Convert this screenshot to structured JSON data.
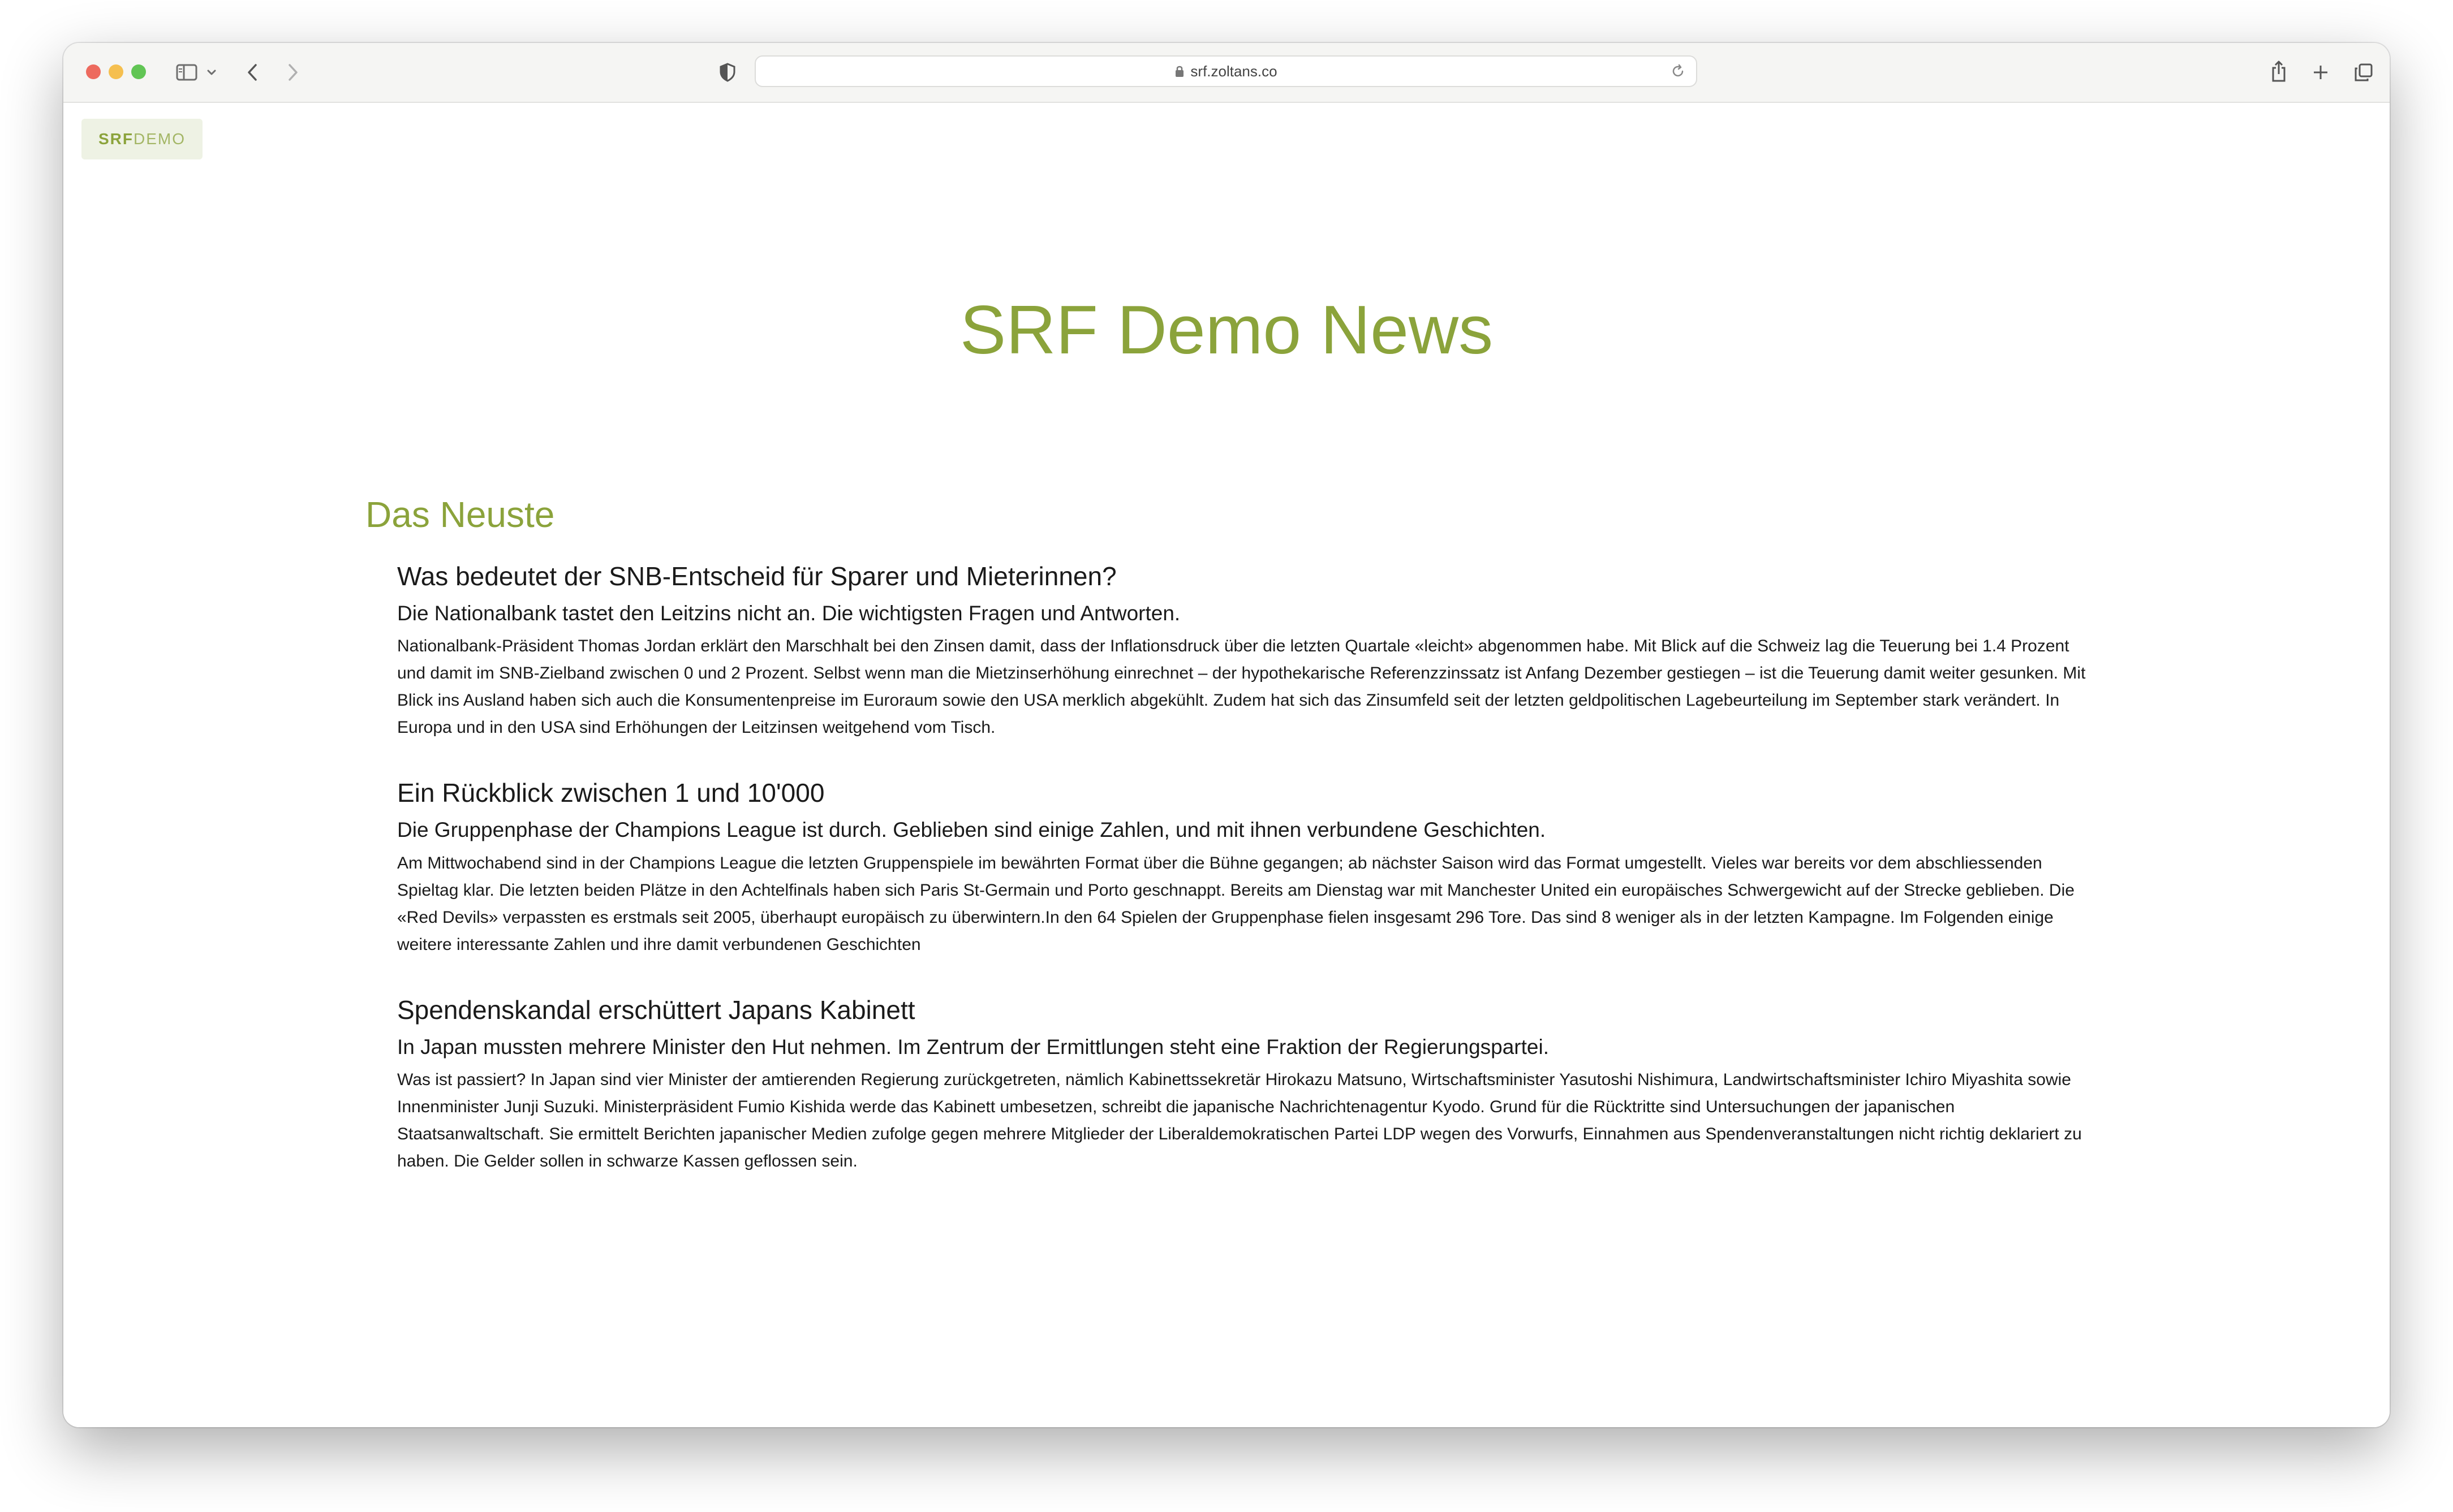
{
  "browser": {
    "url": "srf.zoltans.co",
    "icons": {
      "sidebar": "sidebar-icon",
      "sidebar_menu": "chevron-down-icon",
      "back": "back-arrow-icon",
      "forward": "forward-arrow-icon",
      "privacy": "shield-icon",
      "lock": "lock-icon",
      "reload": "reload-icon",
      "share": "share-icon",
      "new_tab": "plus-icon",
      "tabs": "tabs-overview-icon"
    }
  },
  "site": {
    "logo_srf": "SRF",
    "logo_demo": "DEMO",
    "title": "SRF Demo News",
    "section_title": "Das Neuste",
    "accent_color": "#8ba33b"
  },
  "articles": [
    {
      "title": "Was bedeutet der SNB-Entscheid für Sparer und Mieterinnen?",
      "lead": "Die Nationalbank tastet den Leitzins nicht an. Die wichtigsten Fragen und Antworten.",
      "body": "Nationalbank-Präsident Thomas Jordan erklärt den Marschhalt bei den Zinsen damit, dass der Inflationsdruck über die letzten Quartale «leicht» abgenommen habe. Mit Blick auf die Schweiz lag die Teuerung bei 1.4 Prozent und damit im SNB-Zielband zwischen 0 und 2 Prozent. Selbst wenn man die Mietzinserhöhung einrechnet – der hypothekarische Referenzzinssatz ist Anfang Dezember gestiegen – ist die Teuerung damit weiter gesunken. Mit Blick ins Ausland haben sich auch die Konsumentenpreise im Euroraum sowie den USA merklich abgekühlt. Zudem hat sich das Zinsumfeld seit der letzten geldpolitischen Lagebeurteilung im September stark verändert. In Europa und in den USA sind Erhöhungen der Leitzinsen weitgehend vom Tisch."
    },
    {
      "title": "Ein Rückblick zwischen 1 und 10'000",
      "lead": "Die Gruppenphase der Champions League ist durch. Geblieben sind einige Zahlen, und mit ihnen verbundene Geschichten.",
      "body": "Am Mittwochabend sind in der Champions League die letzten Gruppenspiele im bewährten Format über die Bühne gegangen; ab nächster Saison wird das Format umgestellt. Vieles war bereits vor dem abschliessenden Spieltag klar. Die letzten beiden Plätze in den Achtelfinals haben sich Paris St-Germain und Porto geschnappt. Bereits am Dienstag war mit Manchester United ein europäisches Schwergewicht auf der Strecke geblieben. Die «Red Devils» verpassten es erstmals seit 2005, überhaupt europäisch zu überwintern.In den 64 Spielen der Gruppenphase fielen insgesamt 296 Tore. Das sind 8 weniger als in der letzten Kampagne. Im Folgenden einige weitere interessante Zahlen und ihre damit verbundenen Geschichten"
    },
    {
      "title": "Spendenskandal erschüttert Japans Kabinett",
      "lead": "In Japan mussten mehrere Minister den Hut nehmen. Im Zentrum der Ermittlungen steht eine Fraktion der Regierungspartei.",
      "body": "Was ist passiert? In Japan sind vier Minister der amtierenden Regierung zurückgetreten, nämlich Kabinettssekretär Hirokazu Matsuno, Wirtschaftsminister Yasutoshi Nishimura, Landwirtschaftsminister Ichiro Miyashita sowie Innenminister Junji Suzuki. Ministerpräsident Fumio Kishida werde das Kabinett umbesetzen, schreibt die japanische Nachrichtenagentur Kyodo. Grund für die Rücktritte sind Untersuchungen der japanischen Staatsanwaltschaft. Sie ermittelt Berichten japanischer Medien zufolge gegen mehrere Mitglieder der Liberaldemokratischen Partei LDP wegen des Vorwurfs, Einnahmen aus Spendenveranstaltungen nicht richtig deklariert zu haben. Die Gelder sollen in schwarze Kassen geflossen sein."
    }
  ]
}
